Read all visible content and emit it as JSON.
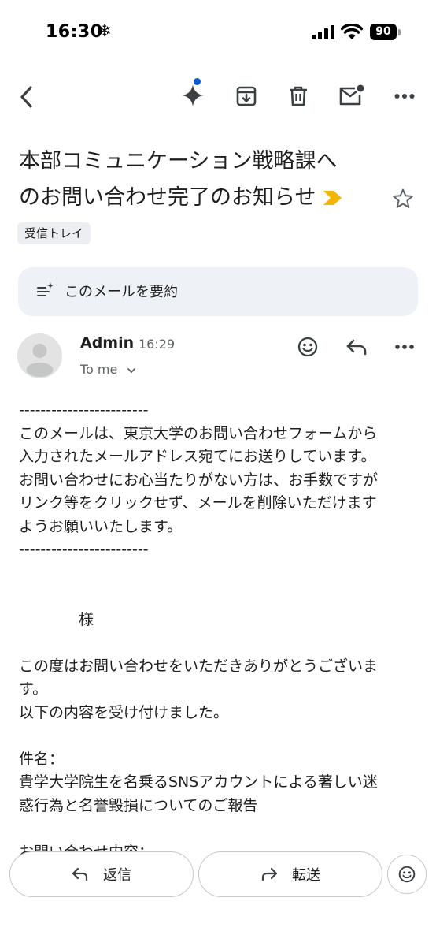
{
  "status_bar": {
    "time": "16:30",
    "mode_icon": "snowflake-icon",
    "battery": "90"
  },
  "toolbar": {
    "back_icon": "chevron-left-icon",
    "gemini_icon": "sparkle-icon",
    "archive_icon": "archive-icon",
    "delete_icon": "trash-icon",
    "unread_icon": "mail-unread-icon",
    "more_icon": "more-horizontal-icon",
    "accent": "#0b57d0"
  },
  "email": {
    "subject_line1": "本部コミュニケーション戦略課へ",
    "subject_line2": "のお問い合わせ完了のお知らせ",
    "importance_color": "#f5b400",
    "label": "受信トレイ",
    "summarize_label": "このメールを要約",
    "sender": "Admin",
    "time": "16:29",
    "recipient": "To me",
    "body": "------------------------\nこのメールは、東京大学のお問い合わせフォームから\n入力されたメールアドレス宛てにお送りしています。\nお問い合わせにお心当たりがない方は、お手数ですが\nリンク等をクリックせず、メールを削除いただけます\nようお願いいたします。\n------------------------\n\n\n　　　　様\n\nこの度はお問い合わせをいただきありがとうございま\nす。\n以下の内容を受け付けました。\n\n件名：\n貴学大学院生を名乗るSNSアカウントによる著しい迷\n惑行為と名誉毀損についてのご報告\n\nお問い合わせ内容："
  },
  "actions": {
    "reply": "返信",
    "forward": "転送"
  }
}
